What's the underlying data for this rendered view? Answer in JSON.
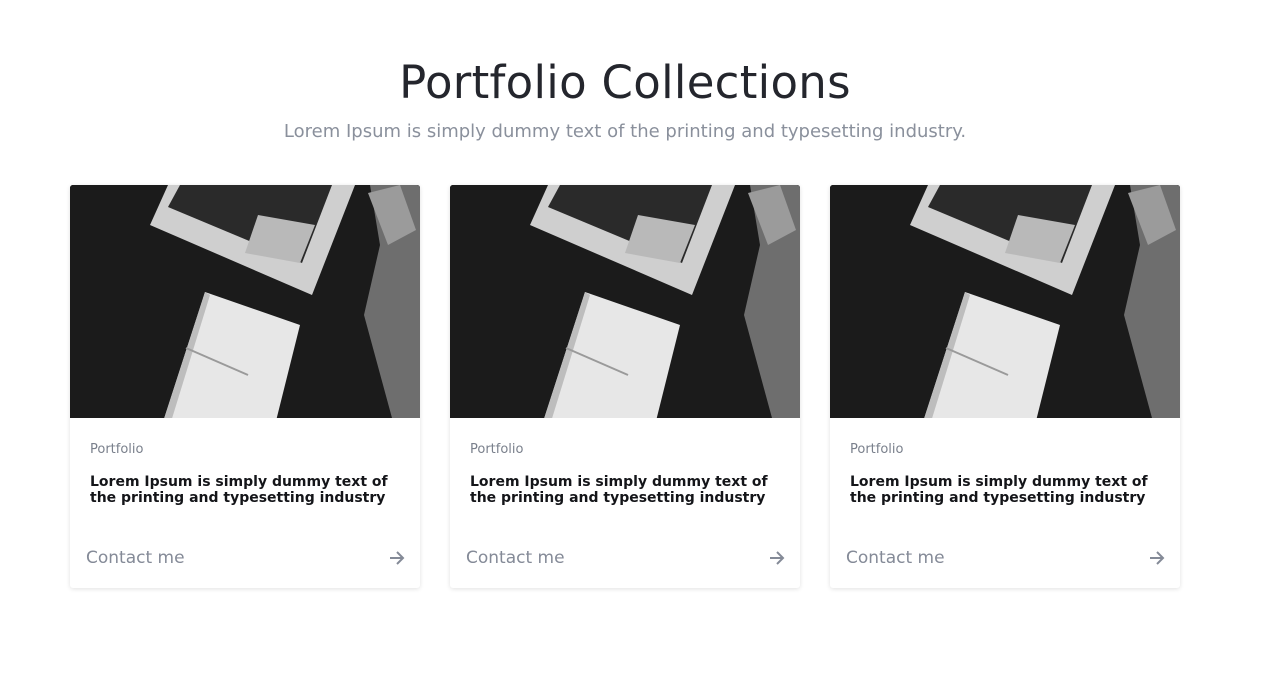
{
  "section": {
    "title": "Portfolio Collections",
    "subtitle": "Lorem Ipsum is simply dummy text of the printing and typesetting industry."
  },
  "cards": [
    {
      "category": "Portfolio",
      "title": "Lorem Ipsum is simply dummy text of the printing and typesetting industry",
      "cta": "Contact me",
      "image": "laptop-notebook-desk-photo",
      "cta_icon": "arrow-right-icon"
    },
    {
      "category": "Portfolio",
      "title": "Lorem Ipsum is simply dummy text of the printing and typesetting industry",
      "cta": "Contact me",
      "image": "laptop-notebook-desk-photo",
      "cta_icon": "arrow-right-icon"
    },
    {
      "category": "Portfolio",
      "title": "Lorem Ipsum is simply dummy text of the printing and typesetting industry",
      "cta": "Contact me",
      "image": "laptop-notebook-desk-photo",
      "cta_icon": "arrow-right-icon"
    }
  ],
  "colors": {
    "title": "#24262d",
    "muted": "#8a909c",
    "card_title": "#141519",
    "cta": "#848a97"
  }
}
